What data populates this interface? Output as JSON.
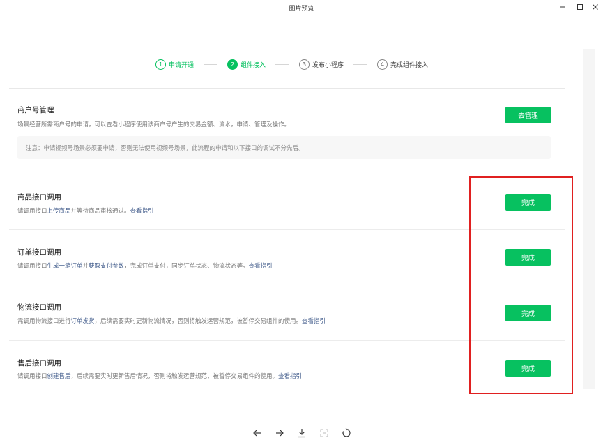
{
  "window": {
    "title": "图片预览"
  },
  "steps": [
    {
      "num": "1",
      "label": "申请开通",
      "state": "done"
    },
    {
      "num": "2",
      "label": "组件接入",
      "state": "active"
    },
    {
      "num": "3",
      "label": "发布小程序",
      "state": "todo"
    },
    {
      "num": "4",
      "label": "完成组件接入",
      "state": "todo"
    }
  ],
  "merchant": {
    "title": "商户号管理",
    "desc": "场景经营所需商户号的申请，可以查看小程序使用该商户号产生的交易金额、流水，申请、管理及操作。",
    "button": "去管理",
    "notice": "注意：申请视频号场景必须要申请，否则无法使用视频号场景，此流程的申请和以下接口的调试不分先后。"
  },
  "product": {
    "title": "商品接口调用",
    "desc_a": "请调用接口",
    "link_1": "上传商品",
    "desc_b": "并等待商品审核通过。",
    "guide": "查看指引",
    "button": "完成"
  },
  "order": {
    "title": "订单接口调用",
    "desc_a": "请调用接口",
    "link_1": "生成一笔订单",
    "desc_b": "并",
    "link_2": "获取支付参数",
    "desc_c": "，完成订单支付，同步订单状态、物流状态等。",
    "guide": "查看指引",
    "button": "完成"
  },
  "logistics": {
    "title": "物流接口调用",
    "desc_a": "需调用物流接口进行",
    "link_1": "订单发货",
    "desc_b": "，后续需要实时更新物流情况，否则将触发运营规范，被暂停交易组件的使用。",
    "guide": "查看指引",
    "button": "完成"
  },
  "aftersale": {
    "title": "售后接口调用",
    "desc_a": "请调用接口",
    "link_1": "创建售后",
    "desc_b": "，后续需要实时更新售后情况，否则将触发运营规范，被暂停交易组件的使用。",
    "guide": "查看指引",
    "button": "完成"
  },
  "colors": {
    "accent": "#07c160",
    "link": "#3f5a8a",
    "highlight_box": "#e02020"
  },
  "toolbar": [
    "arrow-left-icon",
    "arrow-right-icon",
    "download-icon",
    "fit-screen-icon",
    "rotate-icon"
  ]
}
